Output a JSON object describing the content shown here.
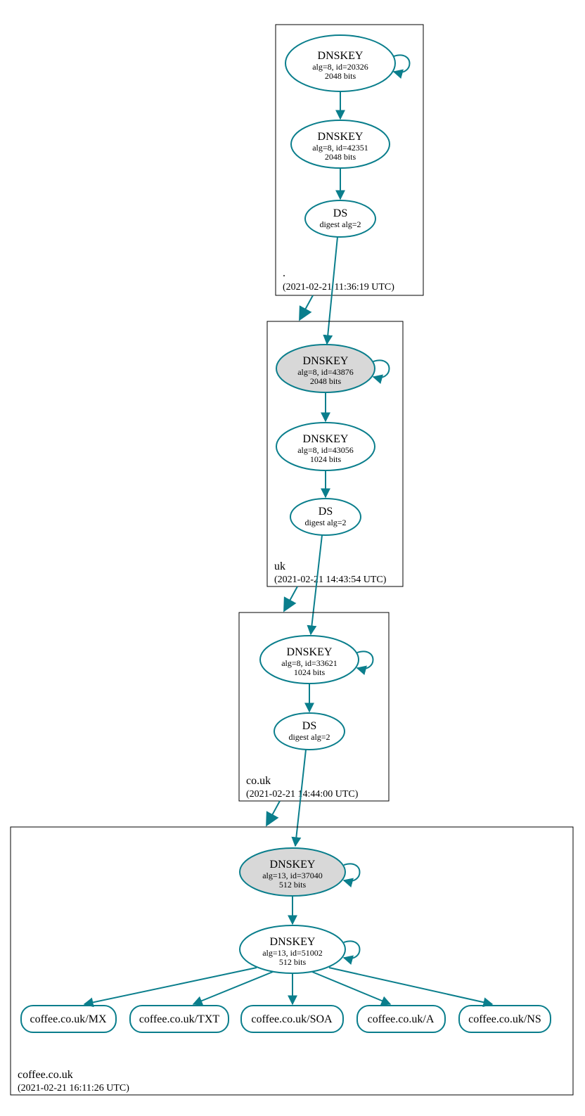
{
  "zones": {
    "root": {
      "title": ".",
      "timestamp": "(2021-02-21 11:36:19 UTC)"
    },
    "uk": {
      "title": "uk",
      "timestamp": "(2021-02-21 14:43:54 UTC)"
    },
    "couk": {
      "title": "co.uk",
      "timestamp": "(2021-02-21 14:44:00 UTC)"
    },
    "coffee": {
      "title": "coffee.co.uk",
      "timestamp": "(2021-02-21 16:11:26 UTC)"
    }
  },
  "nodes": {
    "root_ksk": {
      "title": "DNSKEY",
      "line1": "alg=8, id=20326",
      "line2": "2048 bits"
    },
    "root_zsk": {
      "title": "DNSKEY",
      "line1": "alg=8, id=42351",
      "line2": "2048 bits"
    },
    "root_ds": {
      "title": "DS",
      "line1": "digest alg=2"
    },
    "uk_ksk": {
      "title": "DNSKEY",
      "line1": "alg=8, id=43876",
      "line2": "2048 bits"
    },
    "uk_zsk": {
      "title": "DNSKEY",
      "line1": "alg=8, id=43056",
      "line2": "1024 bits"
    },
    "uk_ds": {
      "title": "DS",
      "line1": "digest alg=2"
    },
    "couk_ksk": {
      "title": "DNSKEY",
      "line1": "alg=8, id=33621",
      "line2": "1024 bits"
    },
    "couk_ds": {
      "title": "DS",
      "line1": "digest alg=2"
    },
    "coffee_ksk": {
      "title": "DNSKEY",
      "line1": "alg=13, id=37040",
      "line2": "512 bits"
    },
    "coffee_zsk": {
      "title": "DNSKEY",
      "line1": "alg=13, id=51002",
      "line2": "512 bits"
    }
  },
  "leaves": {
    "mx": "coffee.co.uk/MX",
    "txt": "coffee.co.uk/TXT",
    "soa": "coffee.co.uk/SOA",
    "a": "coffee.co.uk/A",
    "ns": "coffee.co.uk/NS"
  }
}
